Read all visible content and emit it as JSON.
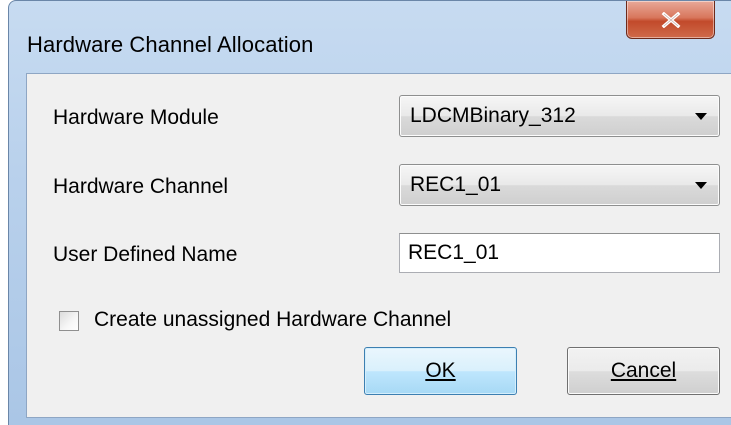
{
  "window": {
    "title": "Hardware Channel Allocation",
    "close_icon": "close-x-icon"
  },
  "form": {
    "hardware_module": {
      "label": "Hardware Module",
      "selected": "LDCMBinary_312"
    },
    "hardware_channel": {
      "label": "Hardware Channel",
      "selected": "REC1_01"
    },
    "user_defined_name": {
      "label": "User Defined Name",
      "value": "REC1_01"
    },
    "create_unassigned": {
      "label": "Create unassigned Hardware Channel",
      "checked": false
    }
  },
  "buttons": {
    "ok_label": "OK",
    "cancel_label": "Cancel"
  },
  "colors": {
    "title_bar": "#b9d1ec",
    "close_button": "#c24a2b",
    "dialog_background": "#f0f0f0",
    "default_button_border": "#3c7fb1"
  }
}
